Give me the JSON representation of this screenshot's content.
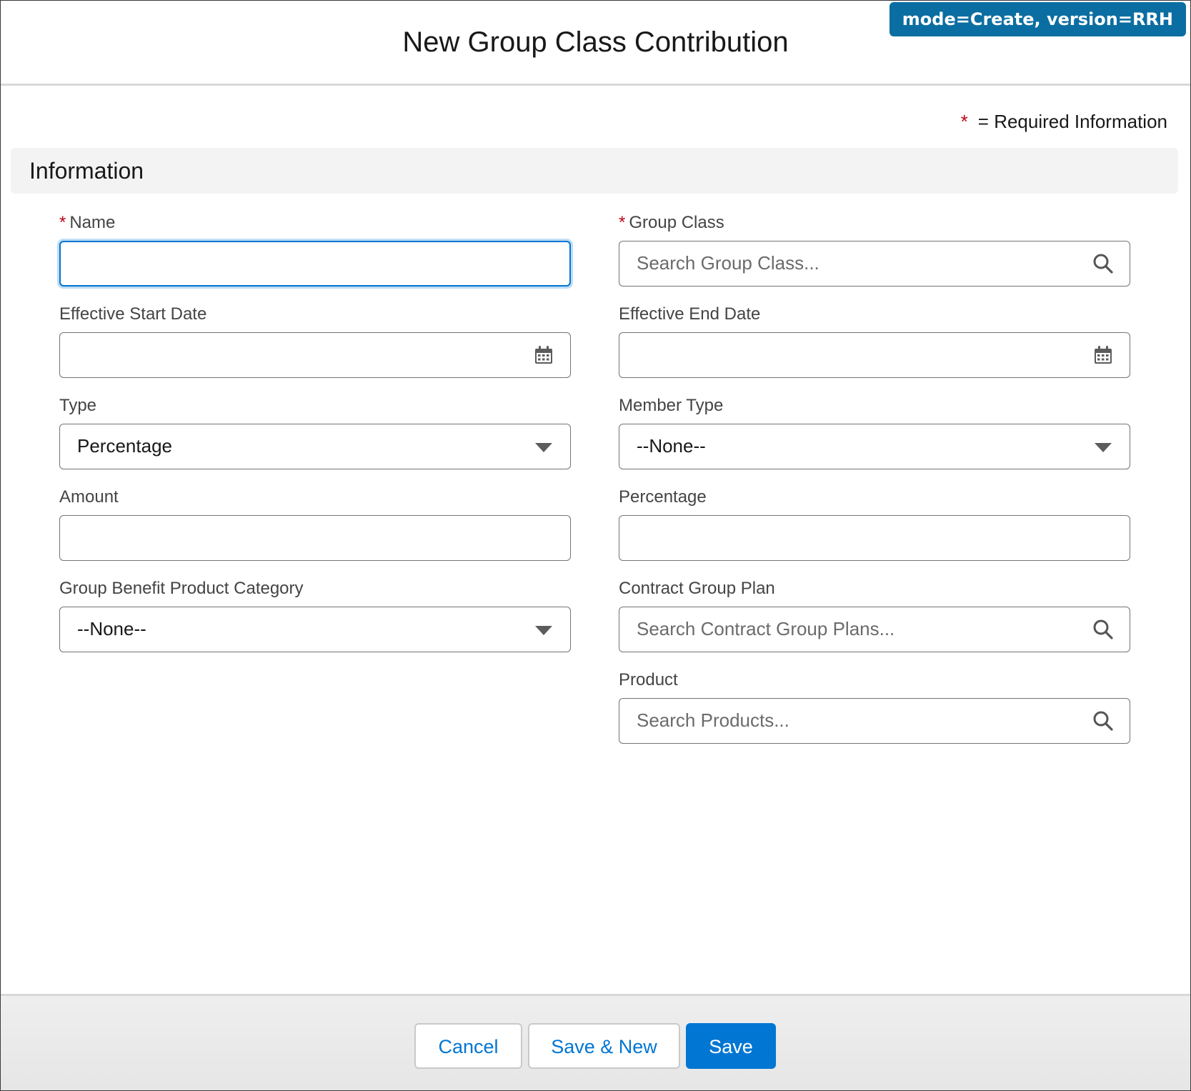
{
  "modal": {
    "title": "New Group Class Contribution",
    "badge": "mode=Create, version=RRH"
  },
  "required_legend": {
    "star": "*",
    "text": "= Required Information"
  },
  "section": {
    "title": "Information"
  },
  "fields": {
    "name": {
      "label": "Name",
      "required": "*",
      "value": ""
    },
    "group_class": {
      "label": "Group Class",
      "required": "*",
      "placeholder": "Search Group Class..."
    },
    "effective_start_date": {
      "label": "Effective Start Date",
      "value": ""
    },
    "effective_end_date": {
      "label": "Effective End Date",
      "value": ""
    },
    "type": {
      "label": "Type",
      "value": "Percentage"
    },
    "member_type": {
      "label": "Member Type",
      "value": "--None--"
    },
    "amount": {
      "label": "Amount",
      "value": ""
    },
    "percentage": {
      "label": "Percentage",
      "value": ""
    },
    "group_benefit_product_category": {
      "label": "Group Benefit Product Category",
      "value": "--None--"
    },
    "contract_group_plan": {
      "label": "Contract Group Plan",
      "placeholder": "Search Contract Group Plans..."
    },
    "product": {
      "label": "Product",
      "placeholder": "Search Products..."
    }
  },
  "footer": {
    "cancel": "Cancel",
    "save_new": "Save & New",
    "save": "Save"
  },
  "colors": {
    "brand": "#0176d3",
    "badge": "#0b6ea2",
    "required": "#ba0517",
    "section_bg": "#f3f3f3"
  },
  "icons": {
    "search": "search-icon",
    "calendar": "calendar-icon",
    "dropdown": "chevron-down-icon"
  }
}
